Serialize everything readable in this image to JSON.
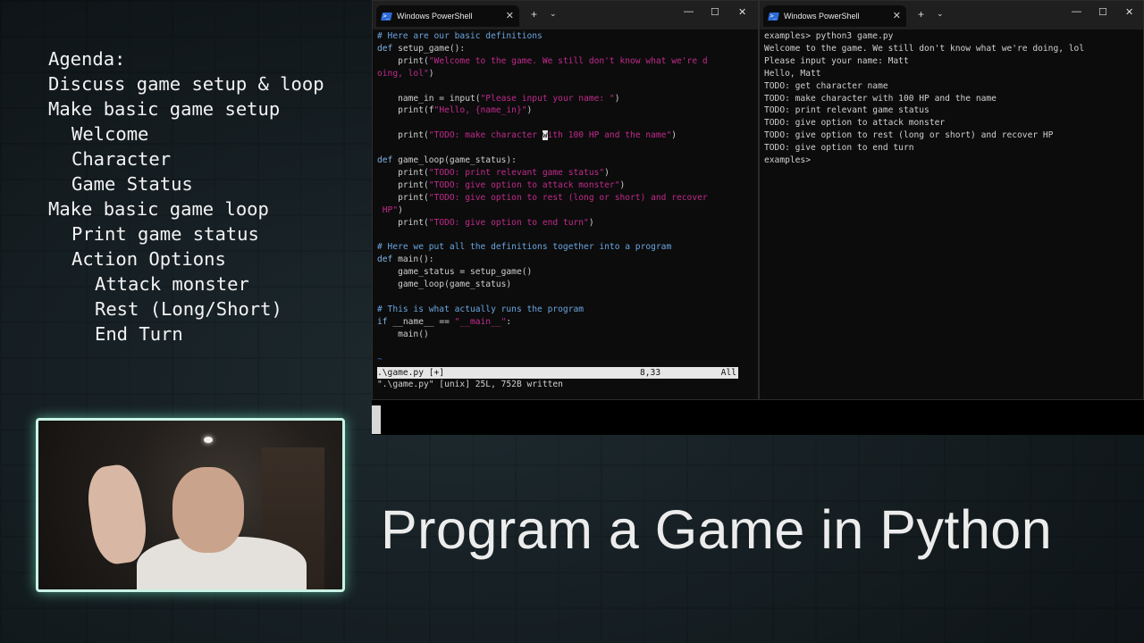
{
  "agenda": [
    {
      "text": "Agenda:",
      "level": 0
    },
    {
      "text": "Discuss game setup & loop",
      "level": 0
    },
    {
      "text": "Make basic game setup",
      "level": 0
    },
    {
      "text": "Welcome",
      "level": 1
    },
    {
      "text": "Character",
      "level": 1
    },
    {
      "text": "Game Status",
      "level": 1
    },
    {
      "text": "Make basic game loop",
      "level": 0
    },
    {
      "text": "Print game status",
      "level": 1
    },
    {
      "text": "Action Options",
      "level": 1
    },
    {
      "text": "Attack monster",
      "level": 2
    },
    {
      "text": "Rest (Long/Short)",
      "level": 2
    },
    {
      "text": "End Turn",
      "level": 2
    }
  ],
  "left_window": {
    "tab_title": "Windows PowerShell",
    "status_file": ".\\game.py [+]",
    "status_pos": "8,33",
    "status_all": "All",
    "cmdline": "\".\\game.py\" [unix] 25L, 752B written"
  },
  "right_window": {
    "tab_title": "Windows PowerShell",
    "lines": [
      "examples> python3 game.py",
      "Welcome to the game. We still don't know what we're doing, lol",
      "Please input your name: Matt",
      "Hello, Matt",
      "TODO: get character name",
      "TODO: make character with 100 HP and the name",
      "TODO: print relevant game status",
      "TODO: give option to attack monster",
      "TODO: give option to rest (long or short) and recover HP",
      "TODO: give option to end turn",
      "examples>"
    ]
  },
  "code": {
    "c1": "# Here are our basic definitions",
    "def_setup": "def",
    "setup_sig": " setup_game():",
    "print_welcome_pre": "    print(",
    "welcome_str": "\"Welcome to the game. We still don't know what we're d",
    "welcome_str2": "oing, lol\"",
    "welcome_close": ")",
    "name_in_pre": "    name_in = input(",
    "name_in_str": "\"Please input your name: \"",
    "name_in_close": ")",
    "hello_pre": "    print(f",
    "hello_str": "\"Hello, {name_in}\"",
    "hello_close": ")",
    "todo_make_pre": "    print(",
    "todo_make_str_a": "\"TODO: make character ",
    "todo_make_cursor": "w",
    "todo_make_str_b": "ith 100 HP and the name\"",
    "todo_make_close": ")",
    "def_loop": "def",
    "loop_sig": " game_loop(game_status):",
    "p1_pre": "    print(",
    "p1_str": "\"TODO: print relevant game status\"",
    "p2_str": "\"TODO: give option to attack monster\"",
    "p3_str": "\"TODO: give option to rest (long or short) and recover",
    "p3_str2": " HP\"",
    "p4_str": "\"TODO: give option to end turn\"",
    "close": ")",
    "c2": "# Here we put all the definitions together into a program",
    "def_main": "def",
    "main_sig": " main():",
    "main_l1": "    game_status = setup_game()",
    "main_l2": "    game_loop(game_status)",
    "c3": "# This is what actually runs the program",
    "if_kw": "if",
    "if_mid": " __name__ == ",
    "if_str": "\"__main__\"",
    "if_end": ":",
    "main_call": "    main()",
    "tilde": "~"
  },
  "video_title": "Program a Game in Python",
  "colors": {
    "keyword": "#7fb2e6",
    "string": "#c02a8c",
    "comment": "#6aa5e0",
    "cam_border": "#c9f3e6"
  }
}
